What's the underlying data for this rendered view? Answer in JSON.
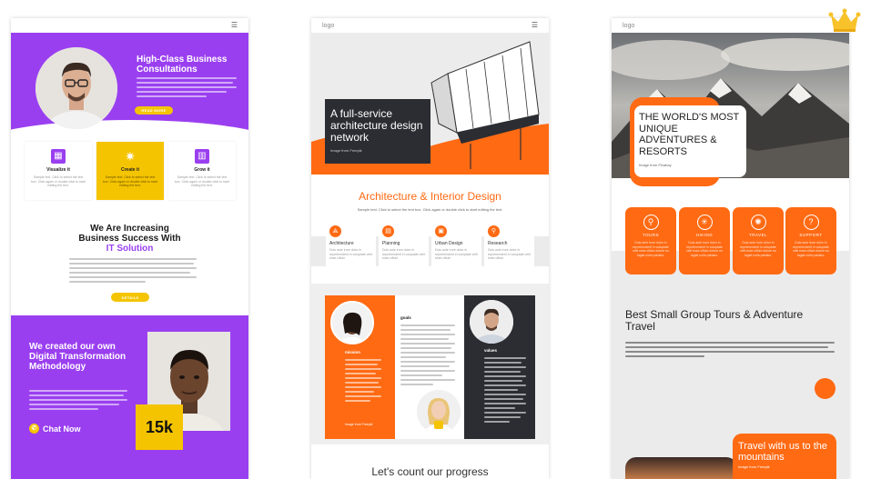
{
  "card1": {
    "title": "High-Class Business Consultations",
    "hero_button": "READ MORE",
    "features": [
      {
        "icon": "grid-icon",
        "title": "Visualize it",
        "desc": "Sample text. Click to select the text box. Click again or double click to start editing the text."
      },
      {
        "icon": "sparkle-icon",
        "title": "Create it",
        "desc": "Sample text. Click to select the text box. Click again or double click to start editing the text."
      },
      {
        "icon": "chart-icon",
        "title": "Grow it",
        "desc": "Sample text. Click to select the text box. Click again or double click to start editing the text."
      }
    ],
    "heading_line1": "We Are Increasing",
    "heading_line2": "Business Success With",
    "heading_accent": "IT Solution",
    "mid_button": "DETAILS",
    "purple_title": "We created our own Digital Transformation Methodology",
    "chat_label": "Chat Now",
    "badge": "15k",
    "colors": {
      "purple": "#9a3ff0",
      "yellow": "#f5c400"
    }
  },
  "card2": {
    "logo": "logo",
    "hero_title": "A full-service architecture design network",
    "hero_caption": "Image from Freepik",
    "subheading": "Architecture & Interior Design",
    "subtext": "Sample text. Click to select the text box. Click again or double click to start editing the text.",
    "features": [
      {
        "icon": "compass-icon",
        "title": "Architecture",
        "desc": "Duis aute irure dolor in reprehenderit in voluptate velit esse cillum"
      },
      {
        "icon": "planning-icon",
        "title": "Planning",
        "desc": "Duis aute irure dolor in reprehenderit in voluptate velit esse cillum"
      },
      {
        "icon": "building-icon",
        "title": "Urban Design",
        "desc": "Duis aute irure dolor in reprehenderit in voluptate velit esse cillum"
      },
      {
        "icon": "research-icon",
        "title": "Research",
        "desc": "Duis aute irure dolor in reprehenderit in voluptate velit esse cillum"
      }
    ],
    "col_labels": [
      "mission",
      "goals",
      "values"
    ],
    "col_caption": "Image from Freepik",
    "footer_text": "Let's count our progress",
    "colors": {
      "orange": "#ff6a13",
      "dark": "#2b2d33"
    }
  },
  "card3": {
    "logo": "logo",
    "hero_title": "THE WORLD'S MOST UNIQUE ADVENTURES & RESORTS",
    "hero_caption": "Image from Pixabay",
    "features": [
      {
        "icon": "bike-icon",
        "title": "TOURS",
        "desc": "Duis aute irure dolor in reprehenderit in voluptate velit esse cillum dolore eu fugiat nulla pariatur."
      },
      {
        "icon": "hiking-icon",
        "title": "HIKING",
        "desc": "Duis aute irure dolor in reprehenderit in voluptate velit esse cillum dolore eu fugiat nulla pariatur."
      },
      {
        "icon": "travel-icon",
        "title": "TRAVEL",
        "desc": "Duis aute irure dolor in reprehenderit in voluptate velit esse cillum dolore eu fugiat nulla pariatur."
      },
      {
        "icon": "support-icon",
        "title": "SUPPORT",
        "desc": "Duis aute irure dolor in reprehenderit in voluptate velit esse cillum dolore eu fugiat nulla pariatur."
      }
    ],
    "heading": "Best Small Group Tours & Adventure Travel",
    "bottom_title": "Travel with us to the mountains",
    "bottom_caption": "Image from Freepik",
    "colors": {
      "orange": "#ff6a13"
    }
  },
  "premium_icon": "crown-icon"
}
